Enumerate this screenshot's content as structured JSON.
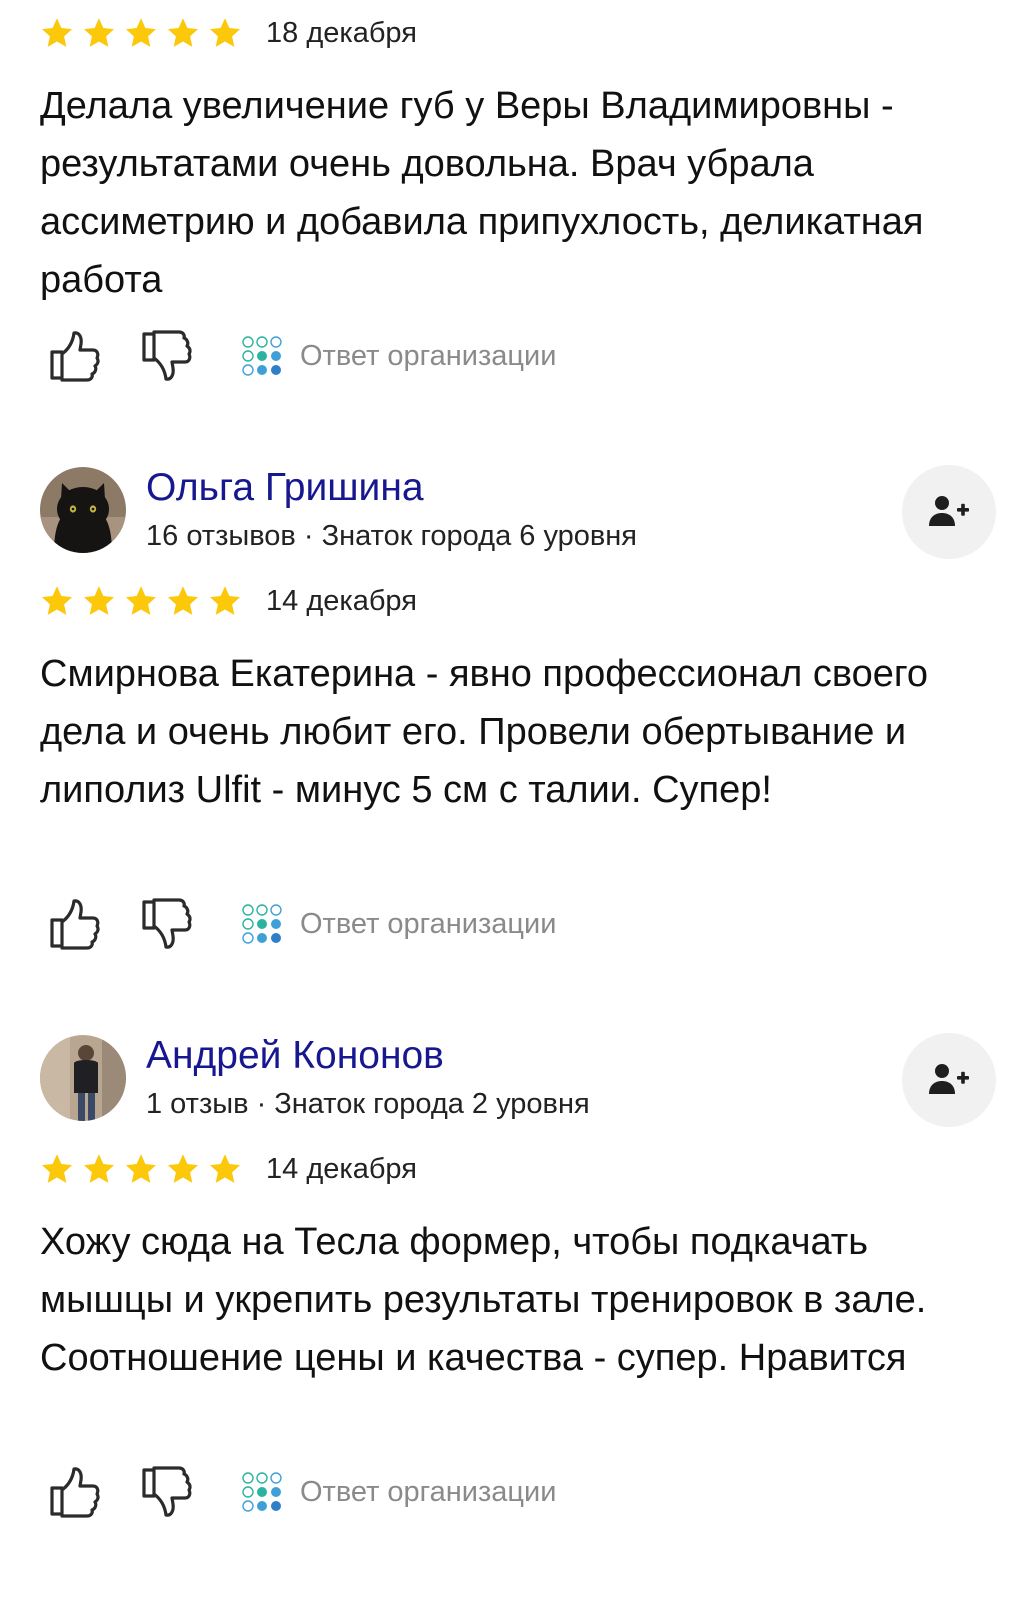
{
  "icons": {
    "star": "star-icon",
    "like": "thumbs-up-icon",
    "dislike": "thumbs-down-icon",
    "subscribe": "add-user-icon",
    "org_logo": "organization-logo-icon"
  },
  "colors": {
    "star": "#fcc80a",
    "author_name": "#17188f",
    "muted_text": "#8a8a8a",
    "subscribe_bg": "#f1f1f1"
  },
  "reviews": [
    {
      "rating": 5,
      "date": "18 декабря",
      "text": "Делала увеличение губ у Веры Владимировны - результатами очень довольна. Врач убрала ассиметрию и добавила припухлость, деликатная работа",
      "org_reply_label": "Ответ организации"
    },
    {
      "author": {
        "name": "Ольга Гришина",
        "meta": "16 отзывов · Знаток города 6 уровня"
      },
      "rating": 5,
      "date": "14 декабря",
      "text": "Смирнова Екатерина - явно профессионал своего дела и очень любит его. Провели обертывание и липолиз Ulfit - минус 5 см с талии. Супер!",
      "org_reply_label": "Ответ организации"
    },
    {
      "author": {
        "name": "Андрей Кононов",
        "meta": "1 отзыв · Знаток города 2 уровня"
      },
      "rating": 5,
      "date": "14 декабря",
      "text": "Хожу сюда на Тесла формер, чтобы подкачать мышцы и укрепить результаты тренировок в зале. Соотношение цены и качества - супер. Нравится",
      "org_reply_label": "Ответ организации"
    }
  ]
}
